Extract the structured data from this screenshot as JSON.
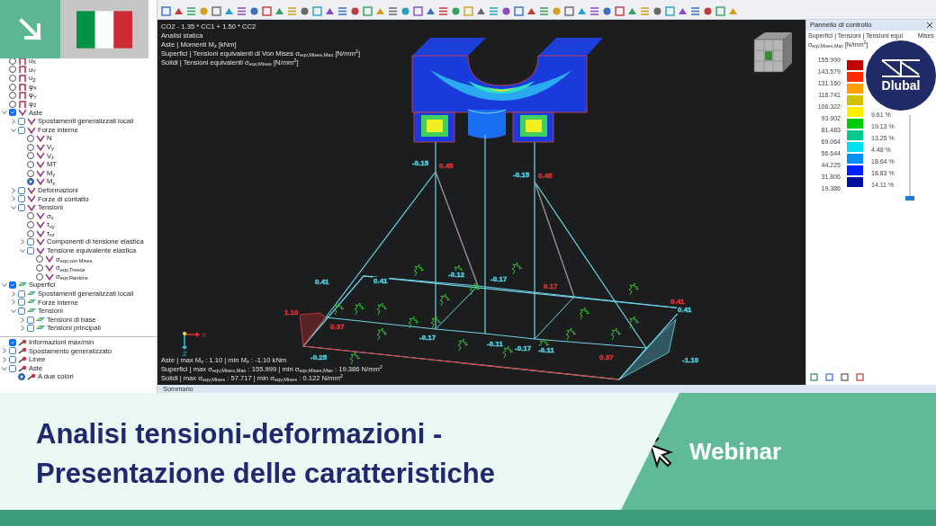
{
  "results_tree": [
    {
      "label": "u$_{X}$",
      "kind": "radio",
      "checked": false
    },
    {
      "label": "u$_{Y}$",
      "kind": "radio",
      "checked": false
    },
    {
      "label": "u$_{Z}$",
      "kind": "radio",
      "checked": false
    },
    {
      "label": "φ$_{X}$",
      "kind": "radio",
      "checked": false
    },
    {
      "label": "φ$_{Y}$",
      "kind": "radio",
      "checked": false
    },
    {
      "label": "φ$_{Z}$",
      "kind": "radio",
      "checked": false
    },
    {
      "label": "Aste",
      "kind": "checkbox",
      "checked": true,
      "expanded": true,
      "children": [
        {
          "label": "Spostamenti generalizzati locali",
          "kind": "checkbox",
          "checked": false,
          "expanded": false
        },
        {
          "label": "Forze interne",
          "kind": "checkbox",
          "checked": false,
          "expanded": true,
          "children": [
            {
              "label": "N",
              "kind": "radio",
              "checked": false
            },
            {
              "label": "V$_{y}$",
              "kind": "radio",
              "checked": false
            },
            {
              "label": "V$_{z}$",
              "kind": "radio",
              "checked": false
            },
            {
              "label": "MT",
              "kind": "radio",
              "checked": false
            },
            {
              "label": "M$_{y}$",
              "kind": "radio",
              "checked": false
            },
            {
              "label": "M$_{z}$",
              "kind": "radio",
              "checked": true
            }
          ]
        },
        {
          "label": "Deformazioni",
          "kind": "checkbox",
          "checked": false,
          "expanded": false
        },
        {
          "label": "Forze di contatto",
          "kind": "checkbox",
          "checked": false,
          "expanded": false
        },
        {
          "label": "Tensioni",
          "kind": "checkbox",
          "checked": false,
          "expanded": true,
          "children": [
            {
              "label": "σ$_{x}$",
              "kind": "radio",
              "checked": false
            },
            {
              "label": "τ$_{xy}$",
              "kind": "radio",
              "checked": false
            },
            {
              "label": "τ$_{xz}$",
              "kind": "radio",
              "checked": false
            },
            {
              "label": "Componenti di tensione elastica",
              "kind": "checkbox",
              "checked": false,
              "expanded": false
            },
            {
              "label": "Tensione equivalente elastica",
              "kind": "checkbox",
              "checked": false,
              "expanded": true,
              "children": [
                {
                  "label": "σ$_{eqv,von Mises}$",
                  "kind": "radio",
                  "checked": false
                },
                {
                  "label": "σ$_{eqv,Tresca}$",
                  "kind": "radio",
                  "checked": false
                },
                {
                  "label": "σ$_{eqv,Rankine}$",
                  "kind": "radio",
                  "checked": false
                }
              ]
            }
          ]
        }
      ]
    },
    {
      "label": "Superfici",
      "kind": "checkbox",
      "checked": true,
      "expanded": true,
      "children": [
        {
          "label": "Spostamenti generalizzati locali",
          "kind": "checkbox",
          "checked": false,
          "expanded": false
        },
        {
          "label": "Forze interne",
          "kind": "checkbox",
          "checked": false,
          "expanded": false
        },
        {
          "label": "Tensioni",
          "kind": "checkbox",
          "checked": false,
          "expanded": true,
          "children": [
            {
              "label": "Tensioni di base",
              "kind": "checkbox",
              "checked": false,
              "expanded": false
            },
            {
              "label": "Tensioni principali",
              "kind": "checkbox",
              "checked": false,
              "expanded": false
            }
          ]
        }
      ]
    }
  ],
  "display_tree": [
    {
      "label": "Informazioni max/min",
      "kind": "checkbox",
      "checked": true
    },
    {
      "label": "Spostamento generalizzato",
      "kind": "checkbox",
      "checked": false,
      "expanded": false
    },
    {
      "label": "Linee",
      "kind": "checkbox",
      "checked": false,
      "expanded": false
    },
    {
      "label": "Aste",
      "kind": "checkbox",
      "checked": false,
      "expanded": true,
      "children": [
        {
          "label": "A due colori",
          "kind": "radio",
          "checked": true
        }
      ]
    }
  ],
  "viewport": {
    "info_top": [
      "CO2 - 1.35 * CC1 + 1.50 * CC2",
      "Analisi statica",
      "Aste | Momenti M$_{z}$ [kNm]",
      "Superfici | Tensioni equivalenti di Von Mises σ$_{eqv,Mises,Max}$ [N/mm$^{2}$]",
      "Solidi | Tensioni equivalenti σ$_{eqv,Mises}$ [N/mm$^{2}$]"
    ],
    "labels": [
      {
        "text": "-0.15",
        "color": "#4fd0e0"
      },
      {
        "text": "0.45",
        "color": "#e03030"
      },
      {
        "text": "-0.15",
        "color": "#4fd0e0"
      },
      {
        "text": "0.45",
        "color": "#e03030"
      },
      {
        "text": "0.41",
        "color": "#4fd0e0"
      },
      {
        "text": "0.41",
        "color": "#4fd0e0"
      },
      {
        "text": "-0.12",
        "color": "#4fd0e0"
      },
      {
        "text": "-0.17",
        "color": "#4fd0e0"
      },
      {
        "text": "0.17",
        "color": "#e03030"
      },
      {
        "text": "1.10",
        "color": "#e03030"
      },
      {
        "text": "0.37",
        "color": "#e03030"
      },
      {
        "text": "-0.17",
        "color": "#4fd0e0"
      },
      {
        "text": "-0.11",
        "color": "#4fd0e0"
      },
      {
        "text": "-0.17",
        "color": "#4fd0e0"
      },
      {
        "text": "-0.11",
        "color": "#4fd0e0"
      },
      {
        "text": "0.41",
        "color": "#e03030"
      },
      {
        "text": "0.41",
        "color": "#4fd0e0"
      },
      {
        "text": "-0.25",
        "color": "#4fd0e0"
      },
      {
        "text": "0.37",
        "color": "#e03030"
      },
      {
        "text": "-1.10",
        "color": "#4fd0e0"
      }
    ],
    "axes": [
      "X",
      "Z"
    ],
    "info_bottom": [
      "Aste | max M$_{z}$ : 1.10 | min M$_{z}$ : -1.10 kNm",
      "Superfici | max σ$_{eqv,Mises,Max}$ : 155.999 | min σ$_{eqv,Mises,Max}$ : 19.386 N/mm$^{2}$",
      "Solidi | max σ$_{eqv,Mises}$ : 57.717 | min σ$_{eqv,Mises}$ : 0.122 N/mm$^{2}$"
    ]
  },
  "summary_bar": {
    "title": "Sommario"
  },
  "control_panel": {
    "title": "Pannello di controllo",
    "subtitle": "Superfici | Tensioni | Tensioni equi",
    "subtitle_end": "Mises",
    "subtitle_line2": "σ$_{eqv,Mises,Max}$ [N/mm$^{2}$]",
    "values": [
      "155.999",
      "143.579",
      "131.160",
      "118.741",
      "106.322",
      "93.902",
      "81.483",
      "69.064",
      "56.644",
      "44.225",
      "31.806",
      "19.386"
    ],
    "bands": [
      {
        "color": "#c00000"
      },
      {
        "color": "#ff2a00"
      },
      {
        "color": "#ffa000"
      },
      {
        "color": "#d4c000"
      },
      {
        "color": "#fff000",
        "percent": "9.61 %"
      },
      {
        "color": "#00cc00",
        "percent": "19.13 %"
      },
      {
        "color": "#00c890",
        "percent": "13.25 %"
      },
      {
        "color": "#00e0f0",
        "percent": "4.48 %"
      },
      {
        "color": "#0090ff",
        "percent": "18.64 %"
      },
      {
        "color": "#0020ff",
        "percent": "18.83 %"
      },
      {
        "color": "#0010a0",
        "percent": "14.11 %"
      }
    ]
  },
  "logo": {
    "text": "Dlubal"
  },
  "banner": {
    "title_lines": [
      "Analisi tensioni-deformazioni -",
      "Presentazione delle caratteristiche"
    ],
    "tag": "Webinar"
  }
}
